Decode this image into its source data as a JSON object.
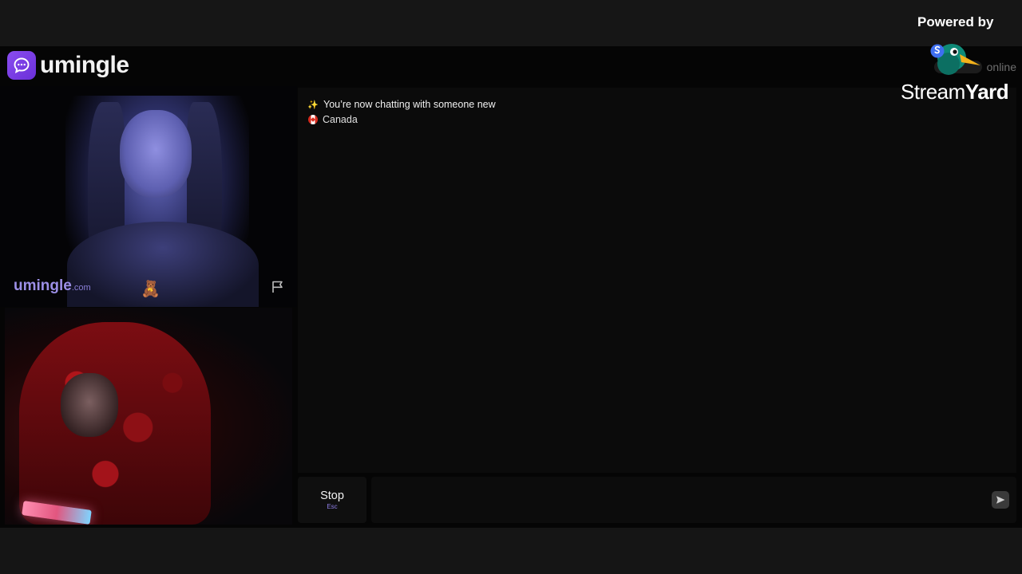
{
  "app": {
    "brand": "umingle",
    "online_label": "online"
  },
  "stranger_video": {
    "watermark": "umingle",
    "watermark_suffix": ".com"
  },
  "chat": {
    "system_message": "You’re now chatting with someone new",
    "country": "Canada",
    "icons": [
      "sparkles-icon",
      "canada-flag-icon"
    ]
  },
  "controls": {
    "stop_label": "Stop",
    "stop_shortcut": "Esc",
    "message_placeholder": ""
  },
  "overlay": {
    "powered_by": "Powered by",
    "brand_part1": "Stream",
    "brand_part2": "Yard"
  },
  "colors": {
    "accent": "#7c3aed",
    "background": "#050505",
    "panel": "#0b0b0b"
  }
}
